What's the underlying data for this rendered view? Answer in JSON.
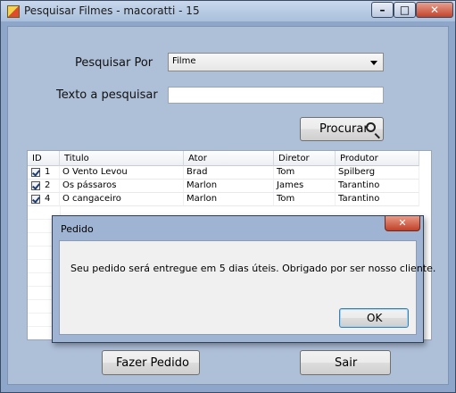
{
  "window": {
    "title": "Pesquisar Filmes - macoratti - 15",
    "min_glyph": "–",
    "max_glyph": "□",
    "close_glyph": "✕"
  },
  "search": {
    "by_label": "Pesquisar Por",
    "by_value": "Filme",
    "text_label": "Texto a pesquisar",
    "text_value": "",
    "search_button": "Procurar"
  },
  "grid": {
    "columns": [
      "ID",
      "Titulo",
      "Ator",
      "Diretor",
      "Produtor"
    ],
    "rows": [
      {
        "checked": true,
        "id": "1",
        "titulo": "O Vento Levou",
        "ator": "Brad",
        "diretor": "Tom",
        "produtor": "Spilberg"
      },
      {
        "checked": true,
        "id": "2",
        "titulo": "Os pássaros",
        "ator": "Marlon",
        "diretor": "James",
        "produtor": "Tarantino"
      },
      {
        "checked": true,
        "id": "4",
        "titulo": "O cangaceiro",
        "ator": "Marlon",
        "diretor": "Tom",
        "produtor": "Tarantino"
      }
    ]
  },
  "footer": {
    "order_button": "Fazer Pedido",
    "exit_button": "Sair"
  },
  "dialog": {
    "title": "Pedido",
    "close_glyph": "✕",
    "message": "Seu pedido será entregue em 5 dias úteis. Obrigado por ser nosso cliente.",
    "ok_button": "OK"
  }
}
